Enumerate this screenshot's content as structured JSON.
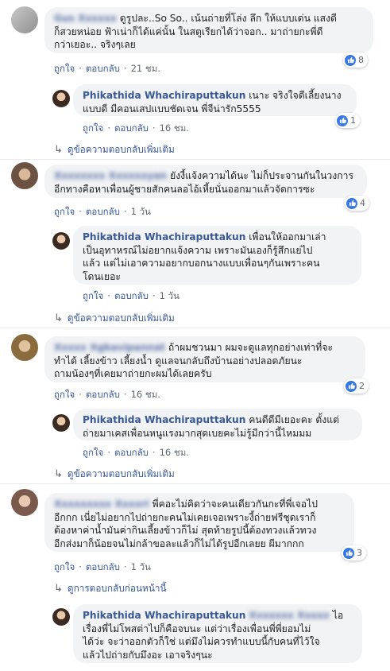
{
  "actions": {
    "like": "ถูกใจ",
    "reply": "ตอบกลับ",
    "sep": "·"
  },
  "comments": [
    {
      "author": "Gus Xxxxxx",
      "text_lines": [
        "ดูรูปละ..So So.. เน้นถ่ายที่โล่ง ลึก ให้แบบเด่น แสงดี",
        "ก็สวยหน่อย ฟ้าเน่าก็ได้แค่นั้น ในสตูเรียกได้ว่าจอก.. มาถ่ายกะพี่ดี",
        "กว่าเยอะ.. จริงๆเลย"
      ],
      "time": "21 ชม.",
      "likes": "8"
    },
    {
      "author": "Phikathida Whachiraputtakun",
      "text_lines": [
        "เนาะ จริงใจดีเลี้ยงนาง",
        "แบบดี มีคอนเสปแบบชัดเจน พี่จีน่ารัก5555"
      ],
      "time": "16 ชม.",
      "likes": "1"
    },
    {
      "more": "ดูข้อความตอบกลับเพิ่มเติม"
    },
    {
      "author": "Xxxxxxxx Xxxxxxyan",
      "text_lines": [
        "ยังงี้แจ้งความได้นะ ไม่ก็ประจานกันในวงการ",
        "อีกทางคือหาเพื่อนผู้ชายสักคนลอไอ้เหี้ยนั่นออกมาแล้วจัดการซะ"
      ],
      "time": "1 วัน",
      "likes": "4"
    },
    {
      "author": "Phikathida Whachiraputtakun",
      "text_lines": [
        "เพื่อนให้ออกมาเล่า",
        "เป็นอุทาหรณ์ไม่อยากแจ้งความ เพราะมันเองก็รู้สึกแย่ไป",
        "แล้ว แต่ไม่เอาความอยากบอกนางแบบเพื่อนๆกันเพราะคน",
        "โดนเยอะ"
      ],
      "time": "1 วัน"
    },
    {
      "more": "ดูข้อความตอบกลับเพิ่มเติม"
    },
    {
      "author": "Xxxxx Xgkavipannat",
      "text_lines": [
        "ถ้าผมชวนมา ผมจะดูแลทุกอย่างเท่าที่จะ",
        "ทำได้ เลี้ยงข้าว เลี้ยงน้ำ ดูแลจนกลับถึงบ้านอย่างปลอดภัยนะ",
        "ถามน้องๆที่เคยมาถ่ายกะผมได้เลยครับ"
      ],
      "time": "16 ชม.",
      "likes": "2"
    },
    {
      "author": "Phikathida Whachiraputtakun",
      "text_lines": [
        "คนดีดีมีเยอะคะ ตั้งแต่",
        "ถ่ายมาเคสเพื่อนหนูแรงมากสุดเบยคะไม่รู้มีกว่านี้ไหมมม"
      ],
      "time": "16 ชม."
    },
    {
      "more": "ดูข้อความตอบกลับเพิ่มเติม"
    },
    {
      "author": "Xxxxxxxxx Xxxxri",
      "text_lines": [
        "พี่คอะไม่คิดว่าจะคนเดียวกันกะที่พี่เจอไป",
        "อีกกก เนี่ยไม่อยากไปถ่ายกะคนไม่เคยเจอเพราะงี้ถ่ายฟรีชุดเราก็",
        "ต้องหาค่าน้ำมันค่ากินเลี้ยงข้าวก็ไม่ สุดท้ายรูปนี้ต้องทวงแล้วทวง",
        "อีกส่งมาก็น้อยจนไม่กล้าขอละแล้วก็ไม่ได้รูปอีกเลยย ผีมากกก"
      ],
      "time": "1 วัน",
      "likes": "3"
    },
    {
      "more": "ดูการตอบกลับก่อนหน้านี้"
    },
    {
      "author": "Phikathida Whachiraputtakun",
      "author_tag": "Xxxxxxx Xxxxx",
      "text_lines": [
        "ไอ",
        "เรื่องพี่ไม่โพสต่าไปก็คือจบนะ แต่ว่าเรื่องเพื่อนพี่พี่ยอมไม่",
        "ได้ว่ะ จะว่าออกตัวก็ใช่ แต่มึงไม่ควรทำแบบนี้กับคนที่ไว้ใจ",
        "แล้วไปถ่ายกับมึงอะ เอาจริงๆนะ"
      ]
    }
  ]
}
